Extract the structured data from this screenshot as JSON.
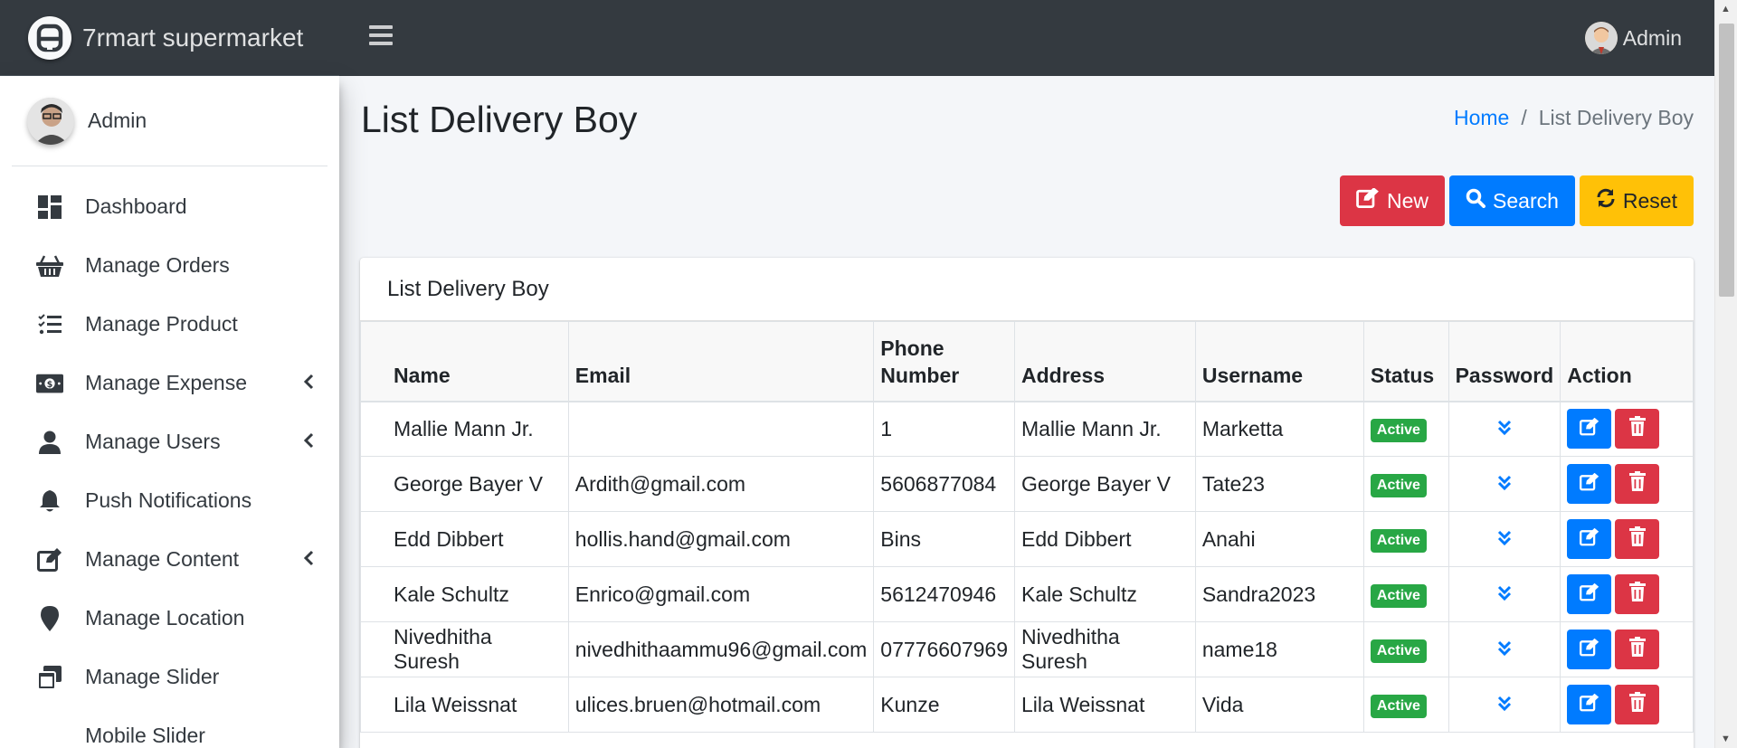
{
  "header": {
    "brand": "7rmart supermarket",
    "user": "Admin"
  },
  "sidebar": {
    "user": "Admin",
    "items": [
      {
        "label": "Dashboard",
        "icon": "dashboard-icon",
        "submenu": false
      },
      {
        "label": "Manage Orders",
        "icon": "basket-icon",
        "submenu": false
      },
      {
        "label": "Manage Product",
        "icon": "tasks-icon",
        "submenu": false
      },
      {
        "label": "Manage Expense",
        "icon": "money-icon",
        "submenu": true
      },
      {
        "label": "Manage Users",
        "icon": "user-icon",
        "submenu": true
      },
      {
        "label": "Push Notifications",
        "icon": "bell-icon",
        "submenu": false
      },
      {
        "label": "Manage Content",
        "icon": "edit-icon",
        "submenu": true
      },
      {
        "label": "Manage Location",
        "icon": "map-marker-icon",
        "submenu": false
      },
      {
        "label": "Manage Slider",
        "icon": "window-icon",
        "submenu": false
      },
      {
        "label": "Mobile Slider",
        "icon": "mobile-icon",
        "submenu": false
      }
    ]
  },
  "page": {
    "title": "List Delivery Boy",
    "breadcrumb": {
      "home": "Home",
      "separator": "/",
      "current": "List Delivery Boy"
    },
    "buttons": {
      "new": "New",
      "search": "Search",
      "reset": "Reset"
    }
  },
  "card": {
    "title": "List Delivery Boy",
    "columns": {
      "name": "Name",
      "email": "Email",
      "phone_1": "Phone",
      "phone_2": "Number",
      "address": "Address",
      "username": "Username",
      "status": "Status",
      "password": "Password",
      "action": "Action"
    },
    "rows": [
      {
        "name": "Mallie Mann Jr.",
        "email": "",
        "phone": "1",
        "address": "Mallie Mann Jr.",
        "username": "Marketta",
        "status": "Active"
      },
      {
        "name": "George Bayer V",
        "email": "Ardith@gmail.com",
        "phone": "5606877084",
        "address": "George Bayer V",
        "username": "Tate23",
        "status": "Active"
      },
      {
        "name": "Edd Dibbert",
        "email": "hollis.hand@gmail.com",
        "phone": "Bins",
        "address": "Edd Dibbert",
        "username": "Anahi",
        "status": "Active"
      },
      {
        "name": "Kale Schultz",
        "email": "Enrico@gmail.com",
        "phone": "5612470946",
        "address": "Kale Schultz",
        "username": "Sandra2023",
        "status": "Active"
      },
      {
        "name": "Nivedhitha Suresh",
        "email": "nivedhithaammu96@gmail.com",
        "phone": "07776607969",
        "address": "Nivedhitha Suresh",
        "username": "name18",
        "status": "Active"
      },
      {
        "name": "Lila Weissnat",
        "email": "ulices.bruen@hotmail.com",
        "phone": "Kunze",
        "address": "Lila Weissnat",
        "username": "Vida",
        "status": "Active"
      }
    ]
  },
  "colors": {
    "topbar": "#343a40",
    "primary": "#007bff",
    "danger": "#dc3545",
    "warning": "#ffc107",
    "success": "#28a745"
  }
}
